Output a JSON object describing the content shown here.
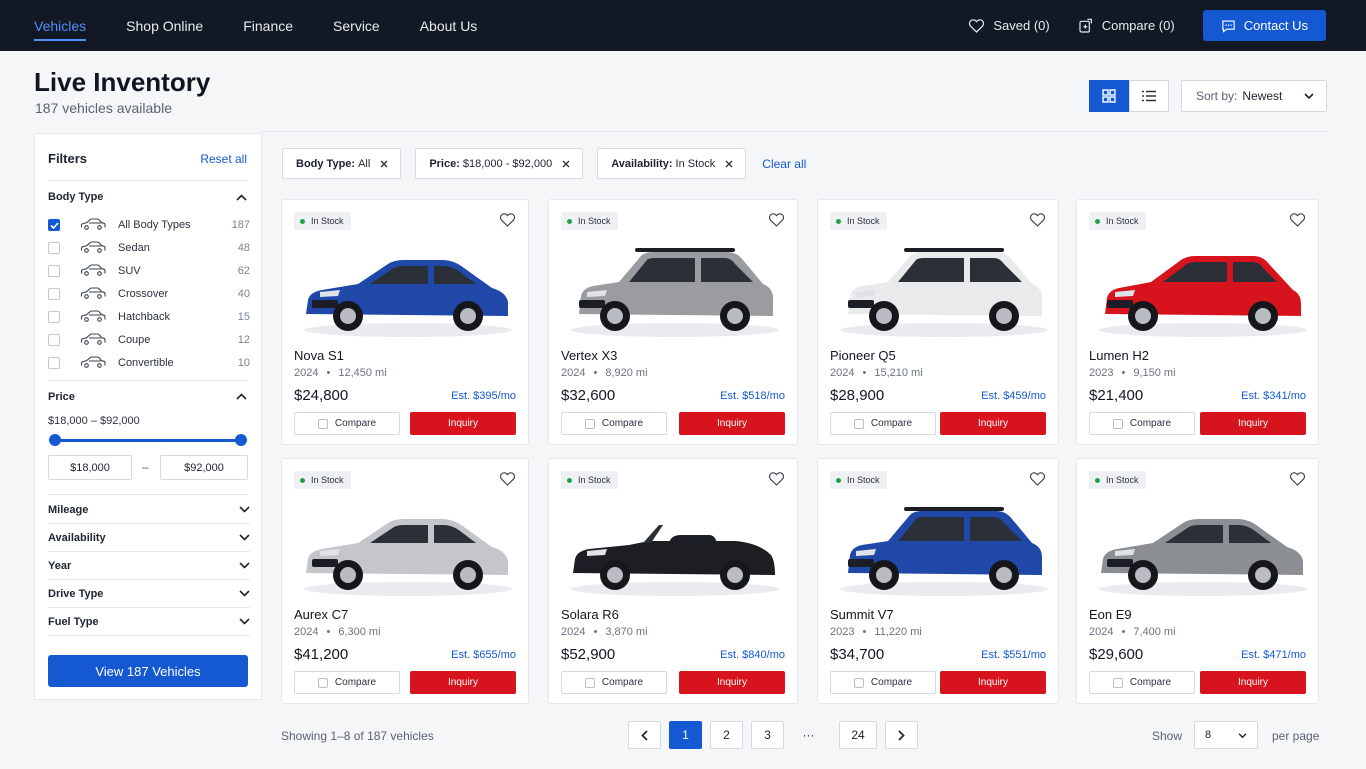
{
  "nav": {
    "links": [
      "Vehicles",
      "Shop Online",
      "Finance",
      "Service",
      "About Us"
    ],
    "saved": "Saved (0)",
    "compare": "Compare (0)",
    "contact": "Contact Us"
  },
  "header": {
    "title": "Live Inventory",
    "subtitle": "187 vehicles available",
    "sort_label": "Sort by:",
    "sort_value": "Newest"
  },
  "filters": {
    "title": "Filters",
    "reset": "Reset all",
    "body_type_title": "Body Type",
    "body_types": [
      {
        "label": "All Body Types",
        "count": "187",
        "checked": true
      },
      {
        "label": "Sedan",
        "count": "48",
        "checked": false
      },
      {
        "label": "SUV",
        "count": "62",
        "checked": false
      },
      {
        "label": "Crossover",
        "count": "40",
        "checked": false
      },
      {
        "label": "Hatchback",
        "count": "15",
        "checked": false
      },
      {
        "label": "Coupe",
        "count": "12",
        "checked": false
      },
      {
        "label": "Convertible",
        "count": "10",
        "checked": false
      }
    ],
    "price_title": "Price",
    "price_range": "$18,000 – $92,000",
    "price_min": "$18,000",
    "price_max": "$92,000",
    "collapsed": [
      "Mileage",
      "Availability",
      "Year",
      "Drive Type",
      "Fuel Type"
    ],
    "view_button": "View 187 Vehicles"
  },
  "chips": [
    {
      "key": "Body Type:",
      "value": "All"
    },
    {
      "key": "Price:",
      "value": "$18,000 - $92,000"
    },
    {
      "key": "Availability:",
      "value": "In Stock"
    }
  ],
  "clear_all": "Clear all",
  "card_labels": {
    "badge": "In Stock",
    "compare": "Compare",
    "inquiry": "Inquiry"
  },
  "vehicles": [
    {
      "name": "Nova S1",
      "year": "2024",
      "miles": "12,450 mi",
      "price": "$24,800",
      "est": "Est. $395/mo",
      "color": "#1f48a8",
      "shape": "sedan"
    },
    {
      "name": "Vertex X3",
      "year": "2024",
      "miles": "8,920 mi",
      "price": "$32,600",
      "est": "Est. $518/mo",
      "color": "#9a9ca0",
      "shape": "suv"
    },
    {
      "name": "Pioneer Q5",
      "year": "2024",
      "miles": "15,210 mi",
      "price": "$28,900",
      "est": "Est. $459/mo",
      "color": "#e9eaec",
      "shape": "suv"
    },
    {
      "name": "Lumen H2",
      "year": "2023",
      "miles": "9,150 mi",
      "price": "$21,400",
      "est": "Est. $341/mo",
      "color": "#d7141e",
      "shape": "hatch"
    },
    {
      "name": "Aurex C7",
      "year": "2024",
      "miles": "6,300 mi",
      "price": "$41,200",
      "est": "Est. $655/mo",
      "color": "#c4c6ca",
      "shape": "coupe"
    },
    {
      "name": "Solara R6",
      "year": "2024",
      "miles": "3,870 mi",
      "price": "$52,900",
      "est": "Est. $840/mo",
      "color": "#1c1e22",
      "shape": "convertible"
    },
    {
      "name": "Summit V7",
      "year": "2023",
      "miles": "11,220 mi",
      "price": "$34,700",
      "est": "Est. $551/mo",
      "color": "#1f48a8",
      "shape": "suv"
    },
    {
      "name": "Eon E9",
      "year": "2024",
      "miles": "7,400 mi",
      "price": "$29,600",
      "est": "Est. $471/mo",
      "color": "#8b8e93",
      "shape": "sedan"
    }
  ],
  "footer": {
    "showing": "Showing 1–8 of 187 vehicles",
    "pages": [
      "1",
      "2",
      "3",
      "···",
      "24"
    ],
    "show_label": "Show",
    "per_page_value": "8",
    "per_page_label": "per page"
  }
}
